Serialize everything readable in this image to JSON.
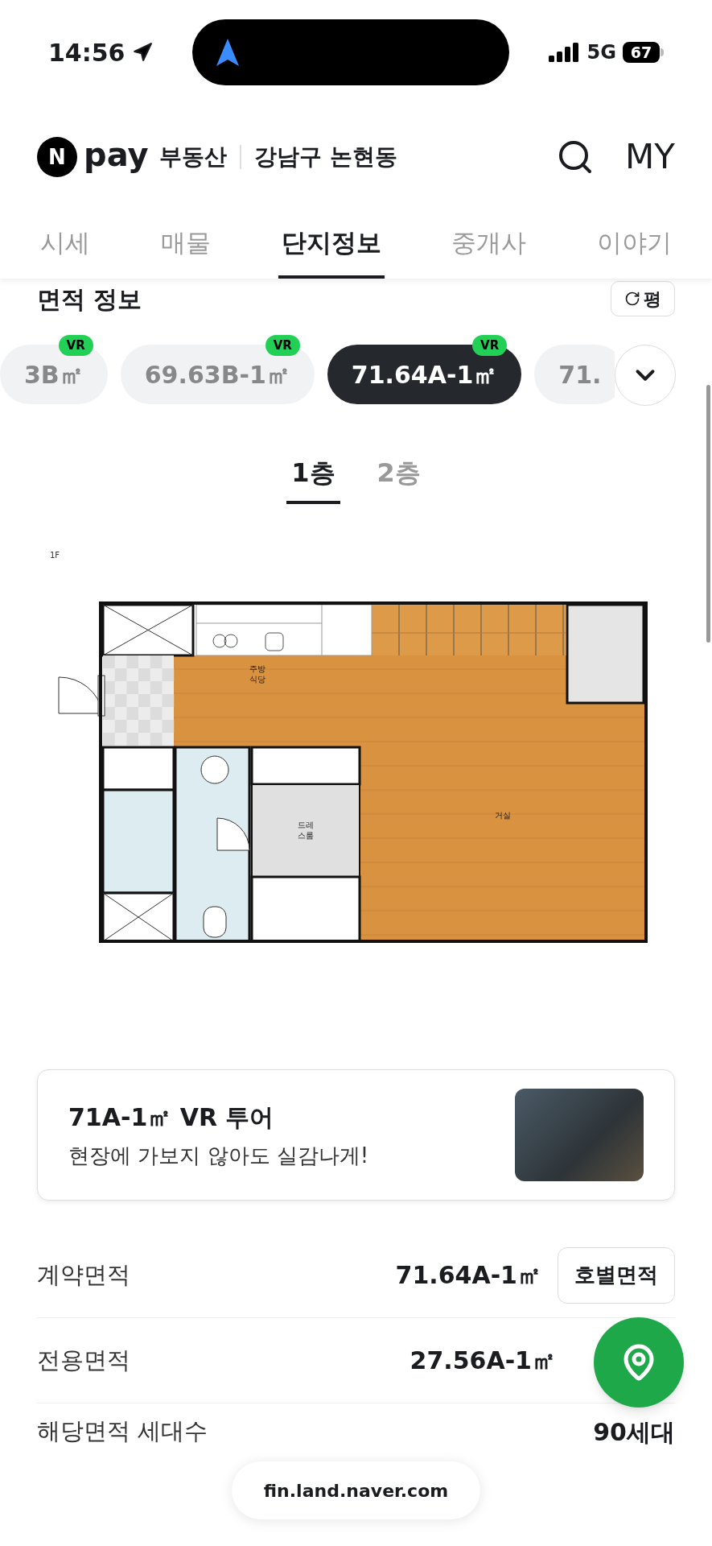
{
  "status_bar": {
    "time": "14:56",
    "network": "5G",
    "battery": "67"
  },
  "header": {
    "logo_mark": "N",
    "logo_name": "pay",
    "service": "부동산",
    "location": "강남구 논현동",
    "my": "MY"
  },
  "tabs": [
    {
      "label": "시세",
      "selected": false
    },
    {
      "label": "매물",
      "selected": false
    },
    {
      "label": "단지정보",
      "selected": true
    },
    {
      "label": "중개사",
      "selected": false
    },
    {
      "label": "이야기",
      "selected": false
    }
  ],
  "section": {
    "title": "면적 정보",
    "unit_button": "평"
  },
  "area_chips": [
    {
      "label": "3B㎡",
      "badge": "VR",
      "selected": false
    },
    {
      "label": "69.63B-1㎡",
      "badge": "VR",
      "selected": false
    },
    {
      "label": "71.64A-1㎡",
      "badge": "VR",
      "selected": true
    },
    {
      "label": "71.",
      "selected": false
    }
  ],
  "floor_tabs": [
    {
      "label": "1층",
      "selected": true
    },
    {
      "label": "2층",
      "selected": false
    }
  ],
  "floor_plan": {
    "floor": "1F",
    "rooms": [
      {
        "kind": "kitchen",
        "lines": [
          "주방",
          "식당"
        ]
      },
      {
        "kind": "dressroom",
        "lines": [
          "드레",
          "스룸"
        ]
      },
      {
        "kind": "living",
        "lines": [
          "거실"
        ]
      }
    ]
  },
  "vr_tour": {
    "title": "71A-1㎡ VR 투어",
    "subtitle": "현장에 가보지 않아도 실감나게!"
  },
  "area_rows": [
    {
      "label": "계약면적",
      "value": "71.64A-1㎡",
      "button": "호별면적"
    },
    {
      "label": "전용면적",
      "value": "27.56A-1㎡"
    },
    {
      "label": "해당면적 세대수",
      "value": "90세대"
    }
  ],
  "url_bar": {
    "url": "fin.land.naver.com"
  }
}
